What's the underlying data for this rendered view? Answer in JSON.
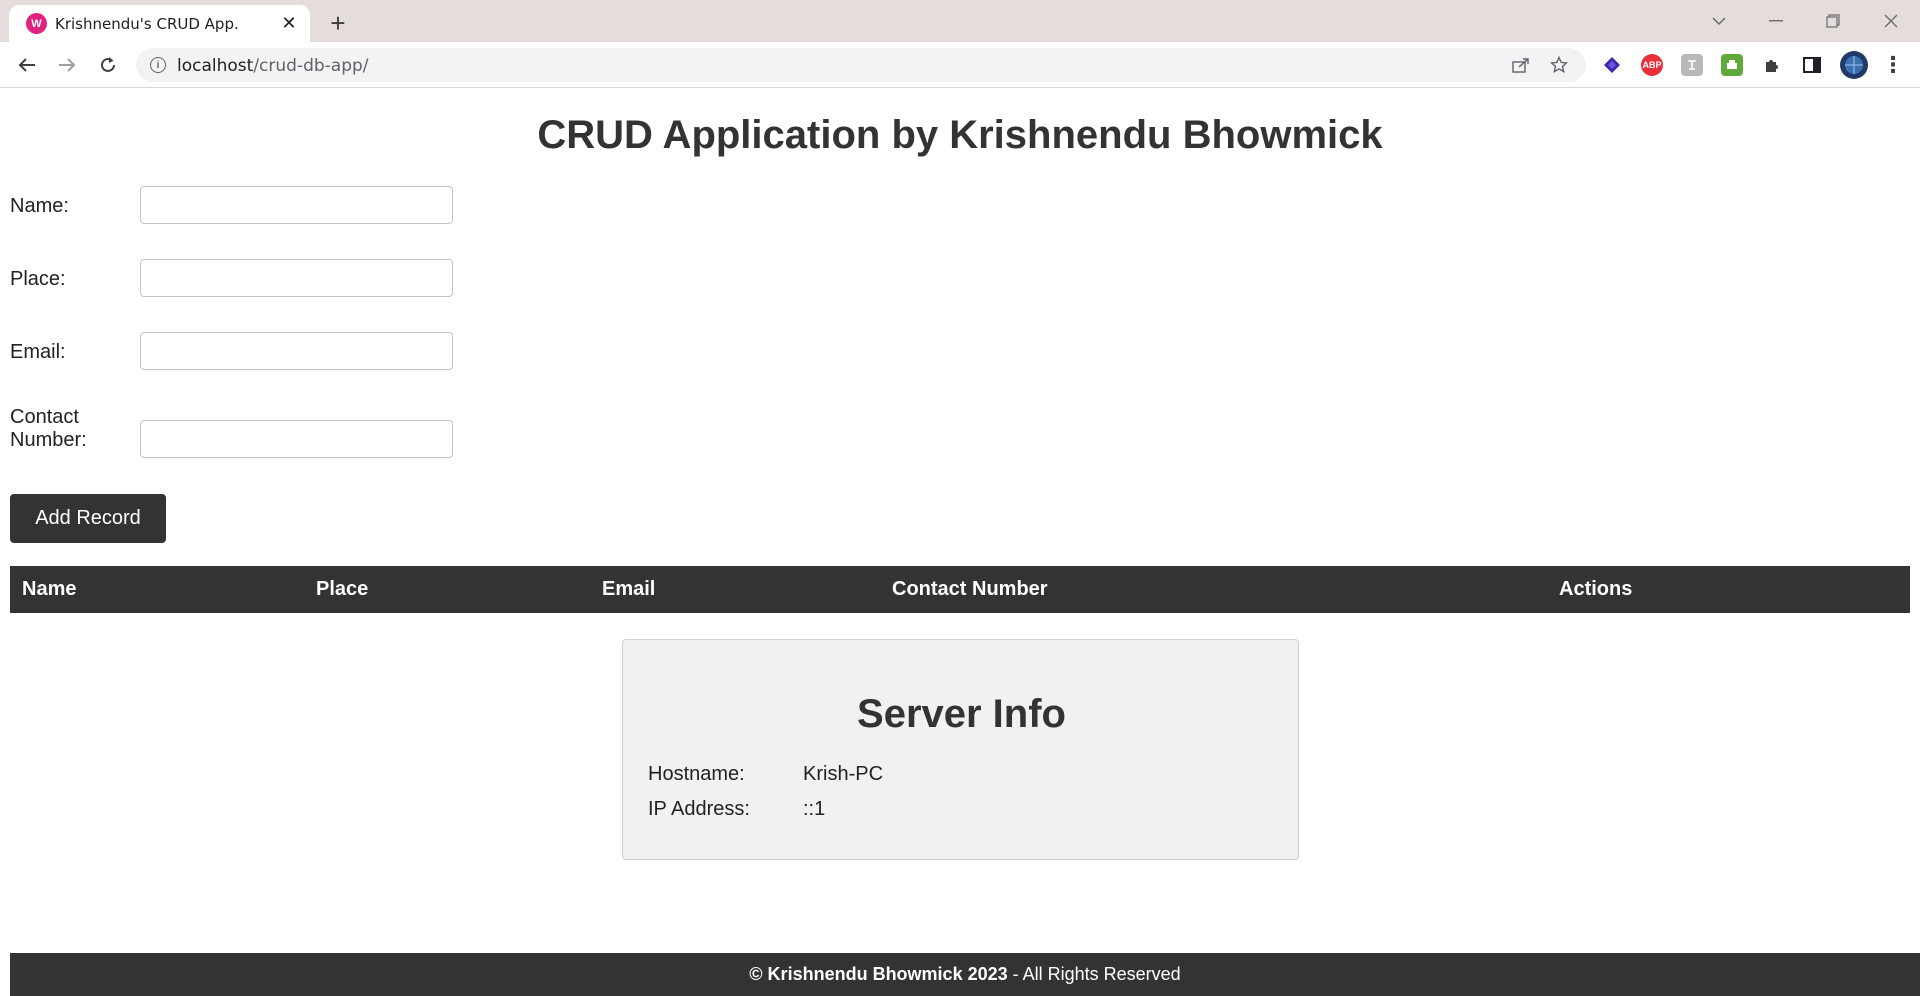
{
  "browser": {
    "tab_title": "Krishnendu's CRUD App.",
    "tab_favicon": "W",
    "url_host": "localhost",
    "url_path": "/crud-db-app/",
    "extensions": [
      "layers-ext-icon",
      "adblock-ext-icon",
      "translate-ext-icon",
      "print-ext-icon",
      "puzzle-icon",
      "side-panel-icon",
      "profile-avatar"
    ],
    "adblock_label": "ABP"
  },
  "page": {
    "title": "CRUD Application by Krishnendu Bhowmick"
  },
  "form": {
    "fields": [
      {
        "label": "Name:",
        "value": "",
        "placeholder": ""
      },
      {
        "label": "Place:",
        "value": "",
        "placeholder": ""
      },
      {
        "label": "Email:",
        "value": "",
        "placeholder": ""
      },
      {
        "label": "Contact Number:",
        "value": "",
        "placeholder": ""
      }
    ],
    "submit_label": "Add Record"
  },
  "table": {
    "headers": [
      "Name",
      "Place",
      "Email",
      "Contact Number",
      "Actions"
    ],
    "rows": []
  },
  "server_info": {
    "title": "Server Info",
    "hostname_label": "Hostname:",
    "hostname_value": "Krish-PC",
    "ip_label": "IP Address:",
    "ip_value": "::1"
  },
  "footer": {
    "copyright": "© Krishnendu Bhowmick 2023",
    "suffix": " - All Rights Reserved"
  },
  "colors": {
    "dark": "#333333",
    "favicon": "#e0237e",
    "panel_bg": "#f1f1f1"
  }
}
